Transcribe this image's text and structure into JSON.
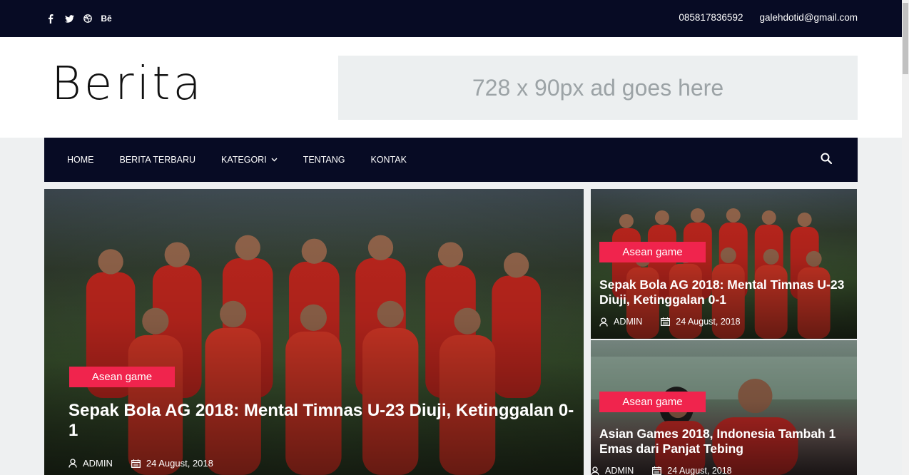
{
  "topbar": {
    "social": [
      "facebook-icon",
      "twitter-icon",
      "dribbble-icon",
      "behance-icon"
    ],
    "behance_text": "Bē",
    "phone": "085817836592",
    "email": "galehdotid@gmail.com"
  },
  "header": {
    "logo": "Berita",
    "ad_text": "728 x 90px ad goes here"
  },
  "nav": {
    "items": [
      {
        "label": "HOME"
      },
      {
        "label": "BERITA TERBARU"
      },
      {
        "label": "KATEGORI"
      },
      {
        "label": "TENTANG"
      },
      {
        "label": "KONTAK"
      }
    ]
  },
  "featured": {
    "main": {
      "category": "Asean game",
      "title": "Sepak Bola AG 2018: Mental Timnas U-23 Diuji, Ketinggalan 0-1",
      "author": "ADMIN",
      "date": "24 August, 2018"
    },
    "side": [
      {
        "category": "Asean game",
        "title": "Sepak Bola AG 2018: Mental Timnas U-23 Diuji, Ketinggalan 0-1",
        "author": "ADMIN",
        "date": "24 August, 2018"
      },
      {
        "category": "Asean game",
        "title": "Asian Games 2018, Indonesia Tambah 1 Emas dari Panjat Tebing",
        "author": "ADMIN",
        "date": "24 August, 2018"
      }
    ]
  },
  "colors": {
    "dark_navy": "#070b24",
    "accent_pink": "#f0244d",
    "page_bg": "#eef0f1",
    "ad_bg": "#eceff0"
  }
}
